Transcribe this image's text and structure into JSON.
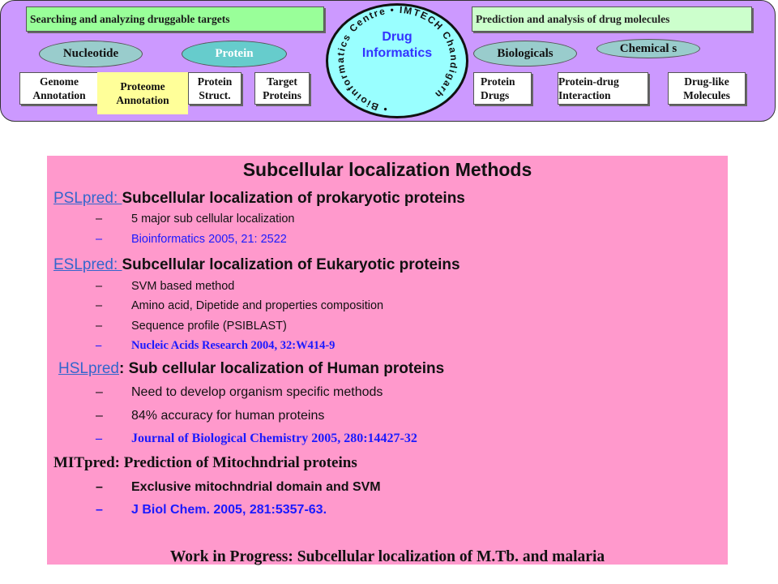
{
  "header": {
    "left_title": "Searching and analyzing druggable targets",
    "right_title": "Prediction and analysis of drug molecules",
    "center_title": "Drug Informatics",
    "center_line1": "Drug",
    "center_line2": "Informatics",
    "circular_text": "• Bioinformatics Centre • IMTECH Chandigarh",
    "pills": {
      "nucleotide": "Nucleotide",
      "protein": "Protein",
      "biologicals": "Biologicals",
      "chemicals": "Chemical s"
    },
    "boxes": {
      "genome": "Genome\nAnnotation",
      "proteome": "Proteome\nAnnotation",
      "protein_struct": "Protein\nStruct.",
      "target": "Target\nProteins",
      "protein_drugs": "Protein\nDrugs",
      "protein_drug_interaction": "Protein-drug\nInteraction",
      "drug_like": "Drug-like\nMolecules"
    },
    "colors": {
      "banner": "#cc99ff",
      "green": "#99ff99",
      "teal": "#99cccc",
      "oval": "#99ffff",
      "proteome": "#ffff99"
    }
  },
  "main": {
    "title": "Subcellular localization Methods",
    "sections": [
      {
        "link": "PSLpred: ",
        "heading": "Subcellular localization of prokaryotic proteins",
        "items": [
          "5 major sub cellular localization",
          "Bioinformatics 2005, 21: 2522"
        ]
      },
      {
        "link": "ESLpred: ",
        "heading": "Subcellular localization of Eukaryotic proteins",
        "items": [
          "SVM based method",
          "Amino acid, Dipetide and properties composition",
          "Sequence profile (PSIBLAST)",
          "Nucleic Acids Research 2004, 32:W414-9"
        ]
      },
      {
        "link": "HSLpred",
        "heading": ": Sub cellular localization of Human proteins",
        "items": [
          "Need to develop organism specific methods",
          "84% accuracy for human proteins",
          "Journal of Biological Chemistry 2005, 280:14427-32"
        ]
      },
      {
        "heading": "MITpred: Prediction of Mitochndrial proteins",
        "items": [
          "Exclusive mitochndrial domain and SVM",
          "J Biol Chem. 2005, 281:5357-63."
        ]
      }
    ],
    "dash": "–",
    "footer": "Work in Progress: Subcellular localization of M.Tb. and malaria",
    "colors": {
      "panel": "#ff99cc",
      "link": "#3366cc",
      "citation": "#1a1aff"
    }
  }
}
